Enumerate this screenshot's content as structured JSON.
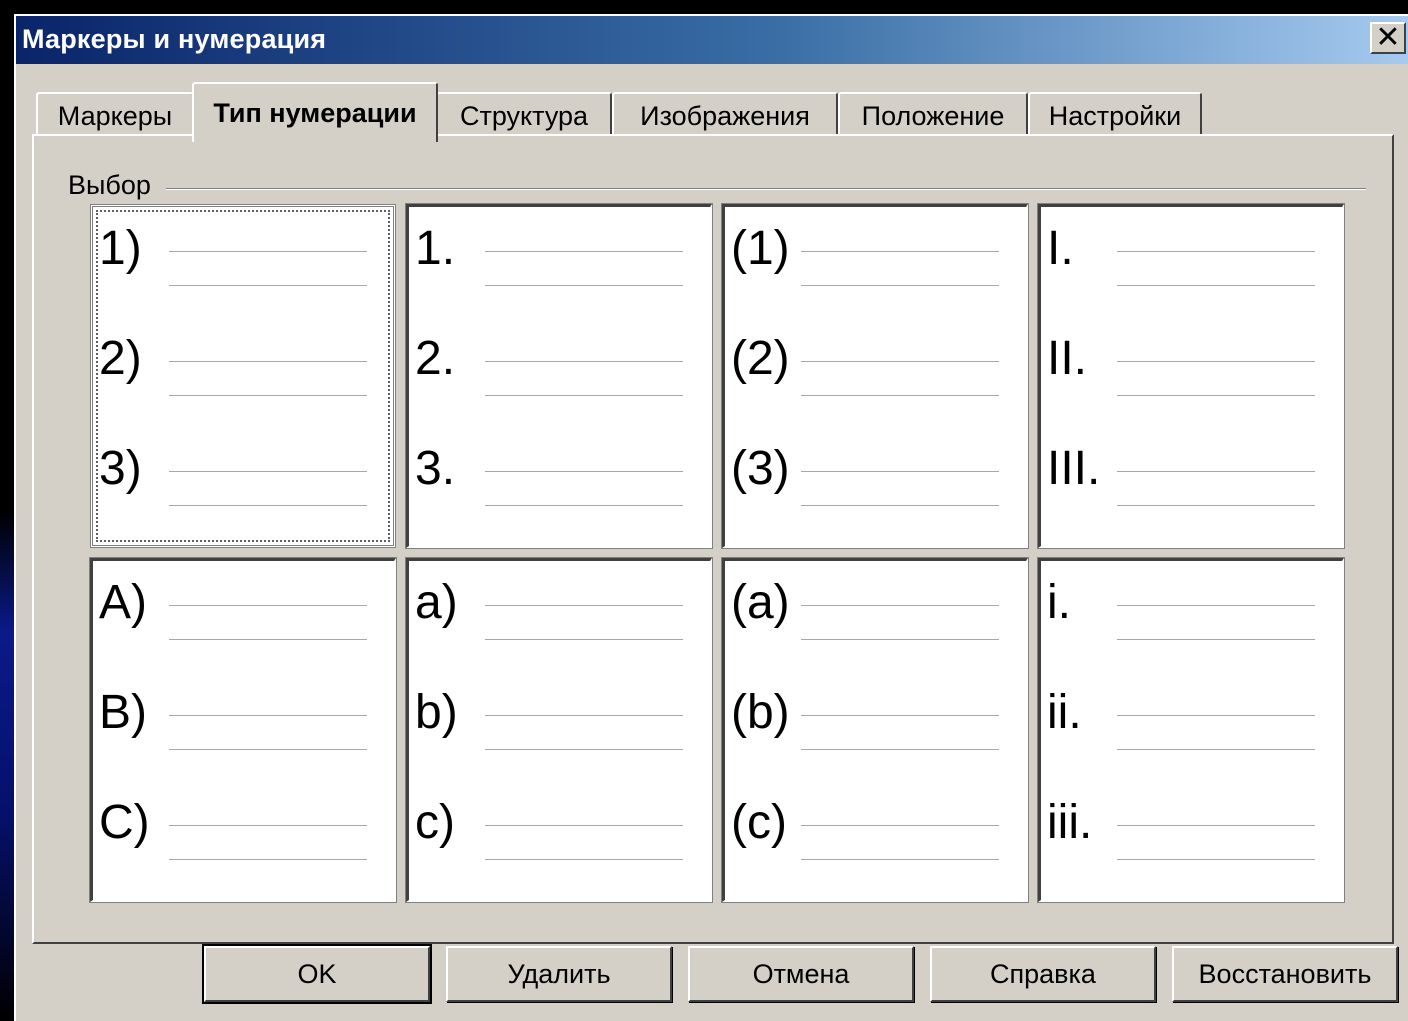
{
  "window": {
    "title": "Маркеры и нумерация",
    "close_glyph": "✕"
  },
  "tabs": [
    {
      "label": "Маркеры",
      "active": false
    },
    {
      "label": "Тип нумерации",
      "active": true
    },
    {
      "label": "Структура",
      "active": false
    },
    {
      "label": "Изображения",
      "active": false
    },
    {
      "label": "Положение",
      "active": false
    },
    {
      "label": "Настройки",
      "active": false
    }
  ],
  "selection": {
    "group_label": "Выбор",
    "selected_index": 0,
    "styles": [
      {
        "items": [
          "1)",
          "2)",
          "3)"
        ]
      },
      {
        "items": [
          "1.",
          "2.",
          "3."
        ]
      },
      {
        "items": [
          "(1)",
          "(2)",
          "(3)"
        ]
      },
      {
        "items": [
          "I.",
          "II.",
          "III."
        ]
      },
      {
        "items": [
          "A)",
          "B)",
          "C)"
        ]
      },
      {
        "items": [
          "a)",
          "b)",
          "c)"
        ]
      },
      {
        "items": [
          "(a)",
          "(b)",
          "(c)"
        ]
      },
      {
        "items": [
          "i.",
          "ii.",
          "iii."
        ]
      }
    ]
  },
  "buttons": {
    "ok": "OK",
    "delete": "Удалить",
    "cancel": "Отмена",
    "help": "Справка",
    "reset": "Восстановить"
  },
  "colors": {
    "dialog_face": "#d4d0c8",
    "title_gradient_start": "#0a246a",
    "title_gradient_end": "#a6caf0"
  }
}
